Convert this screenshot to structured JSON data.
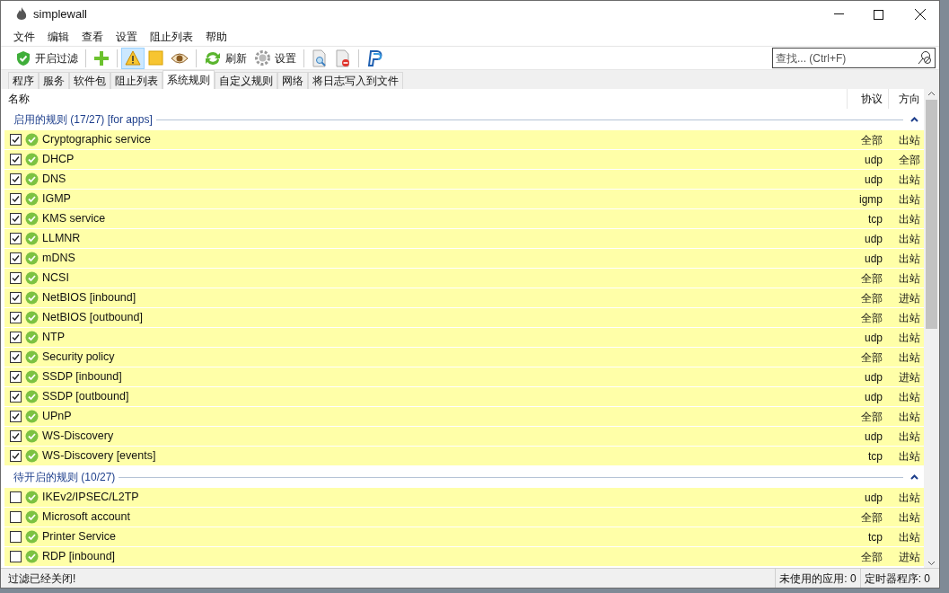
{
  "window": {
    "title": "simplewall"
  },
  "menu": [
    "文件",
    "编辑",
    "查看",
    "设置",
    "阻止列表",
    "帮助"
  ],
  "toolbar": [
    {
      "kind": "shield",
      "label": "开启过滤",
      "selected": false
    },
    {
      "kind": "sep"
    },
    {
      "kind": "plus",
      "selected": false
    },
    {
      "kind": "sep"
    },
    {
      "kind": "warning",
      "selected": true
    },
    {
      "kind": "note",
      "selected": false
    },
    {
      "kind": "eye",
      "selected": false
    },
    {
      "kind": "sep"
    },
    {
      "kind": "refresh",
      "label": "刷新",
      "selected": false
    },
    {
      "kind": "gear",
      "label": "设置",
      "selected": false
    },
    {
      "kind": "sep"
    },
    {
      "kind": "doc-search",
      "selected": false
    },
    {
      "kind": "doc-remove",
      "selected": false
    },
    {
      "kind": "sep"
    },
    {
      "kind": "p-logo",
      "selected": false
    }
  ],
  "search": {
    "placeholder": "查找... (Ctrl+F)"
  },
  "tabs": [
    {
      "label": "程序",
      "selected": false
    },
    {
      "label": "服务",
      "selected": false
    },
    {
      "label": "软件包",
      "selected": false
    },
    {
      "label": "阻止列表",
      "selected": false
    },
    {
      "label": "系统规则",
      "selected": true
    },
    {
      "label": "自定义规则",
      "selected": false
    },
    {
      "label": "网络",
      "selected": false
    },
    {
      "label": "将日志写入到文件",
      "selected": false
    }
  ],
  "table": {
    "columns": [
      "名称",
      "协议",
      "方向"
    ],
    "groups": [
      {
        "title": "启用的规则 (17/27) [for apps]",
        "expanded": true,
        "rows": [
          {
            "name": "Cryptographic service",
            "protocol": "全部",
            "direction": "出站",
            "checked": true
          },
          {
            "name": "DHCP",
            "protocol": "udp",
            "direction": "全部",
            "checked": true
          },
          {
            "name": "DNS",
            "protocol": "udp",
            "direction": "出站",
            "checked": true
          },
          {
            "name": "IGMP",
            "protocol": "igmp",
            "direction": "出站",
            "checked": true
          },
          {
            "name": "KMS service",
            "protocol": "tcp",
            "direction": "出站",
            "checked": true
          },
          {
            "name": "LLMNR",
            "protocol": "udp",
            "direction": "出站",
            "checked": true
          },
          {
            "name": "mDNS",
            "protocol": "udp",
            "direction": "出站",
            "checked": true
          },
          {
            "name": "NCSI",
            "protocol": "全部",
            "direction": "出站",
            "checked": true
          },
          {
            "name": "NetBIOS [inbound]",
            "protocol": "全部",
            "direction": "进站",
            "checked": true
          },
          {
            "name": "NetBIOS [outbound]",
            "protocol": "全部",
            "direction": "出站",
            "checked": true
          },
          {
            "name": "NTP",
            "protocol": "udp",
            "direction": "出站",
            "checked": true
          },
          {
            "name": "Security policy",
            "protocol": "全部",
            "direction": "出站",
            "checked": true
          },
          {
            "name": "SSDP [inbound]",
            "protocol": "udp",
            "direction": "进站",
            "checked": true
          },
          {
            "name": "SSDP [outbound]",
            "protocol": "udp",
            "direction": "出站",
            "checked": true
          },
          {
            "name": "UPnP",
            "protocol": "全部",
            "direction": "出站",
            "checked": true
          },
          {
            "name": "WS-Discovery",
            "protocol": "udp",
            "direction": "出站",
            "checked": true
          },
          {
            "name": "WS-Discovery [events]",
            "protocol": "tcp",
            "direction": "出站",
            "checked": true
          }
        ]
      },
      {
        "title": "待开启的规则 (10/27)",
        "expanded": true,
        "rows": [
          {
            "name": "IKEv2/IPSEC/L2TP",
            "protocol": "udp",
            "direction": "出站",
            "checked": false
          },
          {
            "name": "Microsoft account",
            "protocol": "全部",
            "direction": "出站",
            "checked": false
          },
          {
            "name": "Printer Service",
            "protocol": "tcp",
            "direction": "出站",
            "checked": false
          },
          {
            "name": "RDP [inbound]",
            "protocol": "全部",
            "direction": "进站",
            "checked": false
          }
        ]
      }
    ]
  },
  "status_bar": [
    "过滤已经关闭!",
    "未使用的应用: 0",
    "定时器程序: 0"
  ]
}
